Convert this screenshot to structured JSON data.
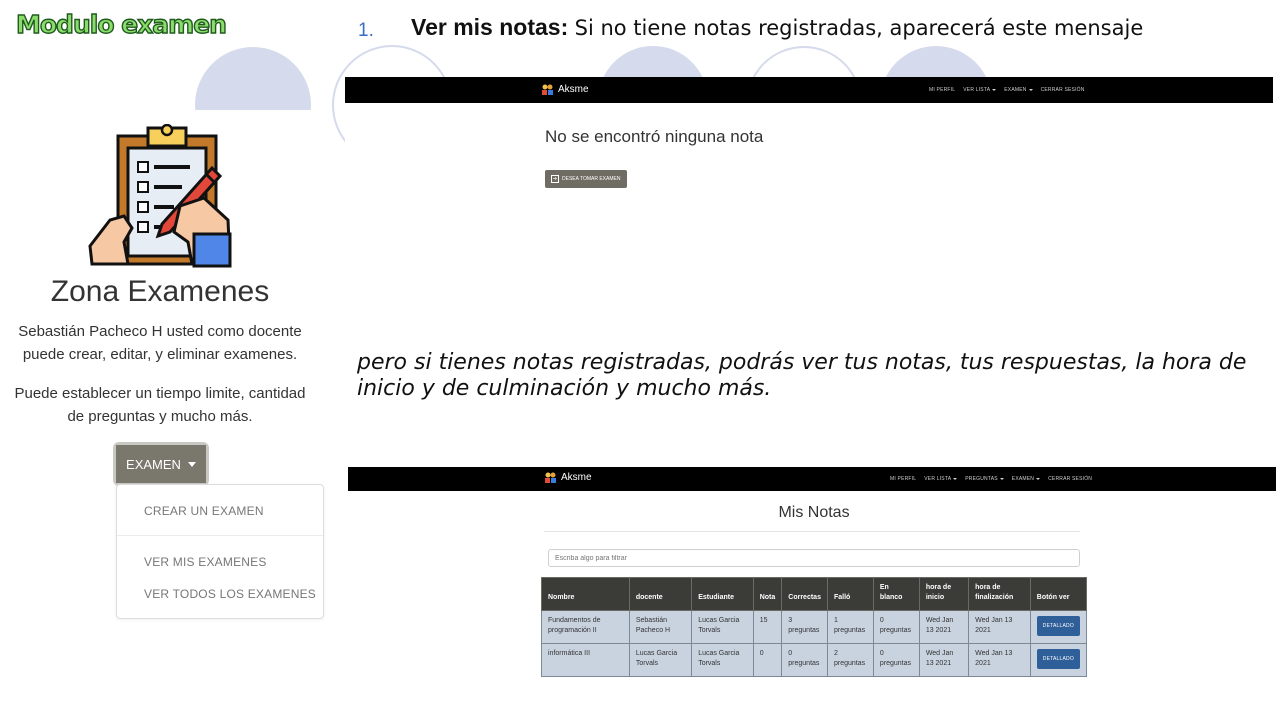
{
  "slide": {
    "title": "Modulo examen",
    "step_number": "1.",
    "heading_bold": "Ver mis notas:",
    "heading_rest": "Si no tiene notas registradas, aparecerá este mensaje",
    "paragraph": "pero si tienes notas registradas, podrás ver tus notas, tus respuestas, la hora de inicio y de culminación y mucho más."
  },
  "left_panel": {
    "title": "Zona Examenes",
    "description_1": "Sebastián Pacheco H usted como docente puede crear, editar, y eliminar examenes.",
    "description_2": "Puede establecer un tiempo limite, cantidad de preguntas y mucho más.",
    "exam_button": "EXAMEN",
    "menu": [
      "CREAR UN EXAMEN",
      "VER MIS EXAMENES",
      "VER TODOS LOS EXAMENES"
    ]
  },
  "screenshot_1": {
    "brand": "Aksme",
    "nav": [
      "MI PERFIL",
      "VER LISTA",
      "EXAMEN",
      "CERRAR SESIÓN"
    ],
    "message": "No se encontró ninguna nota",
    "button": "DESEA TOMAR EXAMEN"
  },
  "screenshot_2": {
    "brand": "Aksme",
    "nav": [
      "MI PERFIL",
      "VER LISTA",
      "PREGUNTAS",
      "EXAMEN",
      "CERRAR SESIÓN"
    ],
    "title": "Mis Notas",
    "filter_placeholder": "Escriba algo para filtrar",
    "columns": [
      "Nombre",
      "docente",
      "Estudiante",
      "Nota",
      "Correctas",
      "Falló",
      "En blanco",
      "hora de inicio",
      "hora de finalización",
      "Botón ver"
    ],
    "rows": [
      [
        "Fundamentos de programación II",
        "Sebastián Pacheco H",
        "Lucas Garcia Torvals",
        "15",
        "3 preguntas",
        "1 preguntas",
        "0 preguntas",
        "Wed Jan 13 2021",
        "Wed Jan 13 2021",
        "DETALLADO"
      ],
      [
        "informática III",
        "Lucas Garcia Torvals",
        "Lucas Garcia Torvals",
        "0",
        "0 preguntas",
        "2 preguntas",
        "0 preguntas",
        "Wed Jan 13 2021",
        "Wed Jan 13 2021",
        "DETALLADO"
      ]
    ]
  },
  "colors": {
    "title_green": "#8bdc6a",
    "exam_button": "#7a776d",
    "navbar": "#000000",
    "table_header": "#3b3b38",
    "table_cell": "#c9d3e0",
    "detail_button": "#2f5f99"
  }
}
